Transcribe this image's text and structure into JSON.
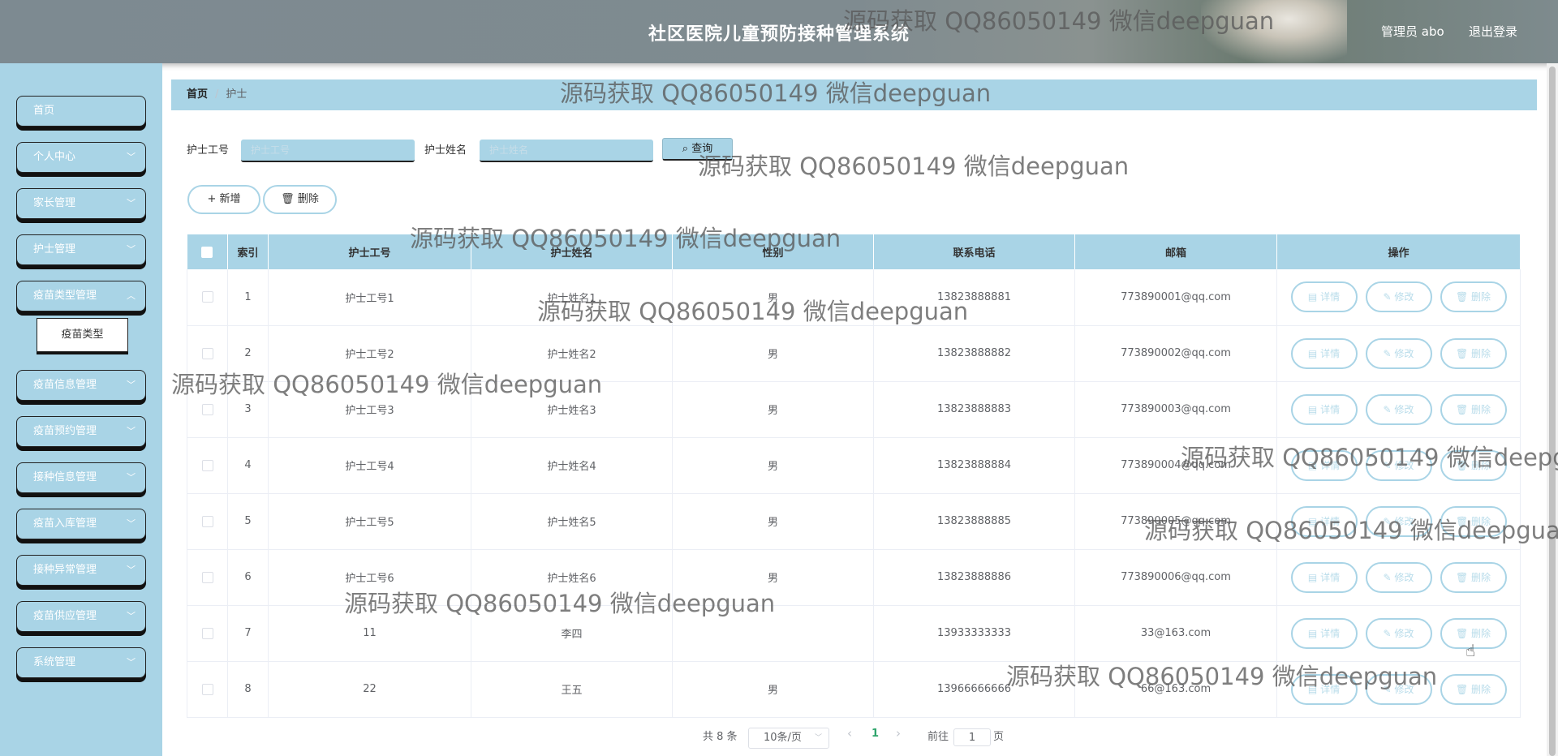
{
  "header": {
    "title": "社区医院儿童预防接种管理系统",
    "user": "管理员 abo",
    "logout": "退出登录"
  },
  "sidebar": {
    "items": [
      {
        "label": "首页",
        "has_children": false
      },
      {
        "label": "个人中心",
        "has_children": true
      },
      {
        "label": "家长管理",
        "has_children": true
      },
      {
        "label": "护士管理",
        "has_children": true
      },
      {
        "label": "疫苗类型管理",
        "has_children": true
      },
      {
        "label": "疫苗信息管理",
        "has_children": true
      },
      {
        "label": "疫苗预约管理",
        "has_children": true
      },
      {
        "label": "接种信息管理",
        "has_children": true
      },
      {
        "label": "疫苗入库管理",
        "has_children": true
      },
      {
        "label": "接种异常管理",
        "has_children": true
      },
      {
        "label": "疫苗供应管理",
        "has_children": true
      },
      {
        "label": "系统管理",
        "has_children": true
      }
    ],
    "submenu": "疫苗类型"
  },
  "breadcrumb": {
    "home": "首页",
    "separator": "/",
    "current": "护士"
  },
  "search": {
    "field1_label": "护士工号",
    "field1_placeholder": "护士工号",
    "field2_label": "护士姓名",
    "field2_placeholder": "护士姓名",
    "button": "查询"
  },
  "actions": {
    "add": "新增",
    "delete": "删除"
  },
  "table": {
    "headers": [
      "索引",
      "护士工号",
      "护士姓名",
      "性别",
      "联系电话",
      "邮箱",
      "操作"
    ],
    "op_labels": [
      "详情",
      "修改",
      "删除"
    ],
    "rows": [
      [
        "1",
        "护士工号1",
        "护士姓名1",
        "男",
        "13823888881",
        "773890001@qq.com"
      ],
      [
        "2",
        "护士工号2",
        "护士姓名2",
        "男",
        "13823888882",
        "773890002@qq.com"
      ],
      [
        "3",
        "护士工号3",
        "护士姓名3",
        "男",
        "13823888883",
        "773890003@qq.com"
      ],
      [
        "4",
        "护士工号4",
        "护士姓名4",
        "男",
        "13823888884",
        "773890004@qq.com"
      ],
      [
        "5",
        "护士工号5",
        "护士姓名5",
        "男",
        "13823888885",
        "773890005@qq.com"
      ],
      [
        "6",
        "护士工号6",
        "护士姓名6",
        "男",
        "13823888886",
        "773890006@qq.com"
      ],
      [
        "7",
        "11",
        "李四",
        "",
        "13933333333",
        "33@163.com"
      ],
      [
        "8",
        "22",
        "王五",
        "男",
        "13966666666",
        "66@163.com"
      ]
    ]
  },
  "pagination": {
    "total": "共 8 条",
    "page_size": "10条/页",
    "prev": "‹",
    "next": "›",
    "current_page": "1",
    "goto_label": "前往",
    "goto_value": "1",
    "page_unit": "页"
  },
  "watermark": "源码获取 QQ86050149 微信deepguan",
  "colors": {
    "accent": "#a9d4e6",
    "header": "#7f8b90"
  }
}
